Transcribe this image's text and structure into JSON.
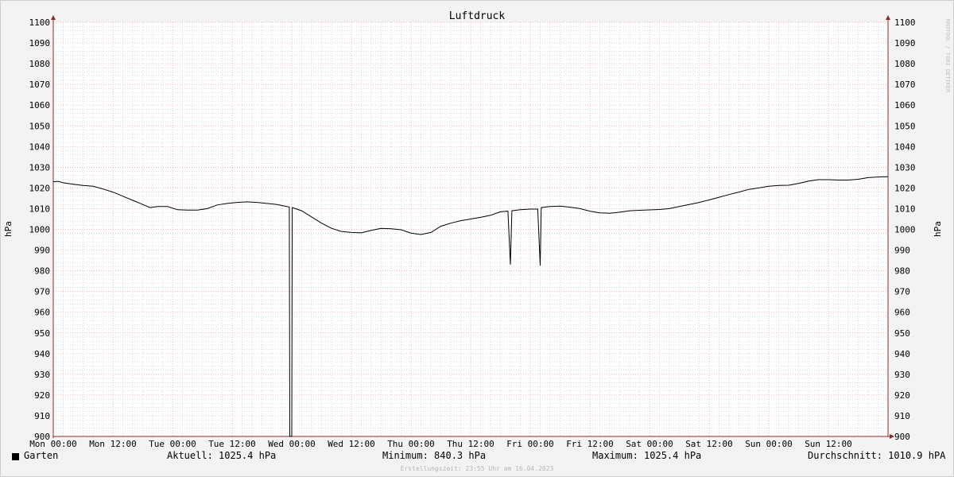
{
  "chart_data": {
    "type": "line",
    "title": "Luftdruck",
    "ylabel_left": "hPa",
    "ylabel_right": "hPa",
    "ylim": [
      900,
      1100
    ],
    "yticks": [
      900,
      910,
      920,
      930,
      940,
      950,
      960,
      970,
      980,
      990,
      1000,
      1010,
      1020,
      1030,
      1040,
      1050,
      1060,
      1070,
      1080,
      1090,
      1100
    ],
    "xlim": [
      0,
      168
    ],
    "xticks": [
      {
        "h": 0,
        "label": "Mon 00:00"
      },
      {
        "h": 12,
        "label": "Mon 12:00"
      },
      {
        "h": 24,
        "label": "Tue 00:00"
      },
      {
        "h": 36,
        "label": "Tue 12:00"
      },
      {
        "h": 48,
        "label": "Wed 00:00"
      },
      {
        "h": 60,
        "label": "Wed 12:00"
      },
      {
        "h": 72,
        "label": "Thu 00:00"
      },
      {
        "h": 84,
        "label": "Thu 12:00"
      },
      {
        "h": 96,
        "label": "Fri 00:00"
      },
      {
        "h": 108,
        "label": "Fri 12:00"
      },
      {
        "h": 120,
        "label": "Sat 00:00"
      },
      {
        "h": 132,
        "label": "Sat 12:00"
      },
      {
        "h": 144,
        "label": "Sun 00:00"
      },
      {
        "h": 156,
        "label": "Sun 12:00"
      }
    ],
    "grid": true,
    "series": [
      {
        "name": "Garten",
        "color": "#000000",
        "points": [
          [
            0,
            1023
          ],
          [
            1,
            1023.2
          ],
          [
            2,
            1022.5
          ],
          [
            4,
            1021.8
          ],
          [
            6,
            1021.2
          ],
          [
            8,
            1020.8
          ],
          [
            10,
            1019.5
          ],
          [
            12,
            1018
          ],
          [
            14,
            1016
          ],
          [
            16,
            1014
          ],
          [
            18,
            1012
          ],
          [
            19.5,
            1010.5
          ],
          [
            21,
            1011
          ],
          [
            23,
            1011
          ],
          [
            25,
            1009.5
          ],
          [
            27,
            1009.3
          ],
          [
            29,
            1009.3
          ],
          [
            31,
            1010
          ],
          [
            33,
            1011.8
          ],
          [
            35,
            1012.5
          ],
          [
            37,
            1013
          ],
          [
            39,
            1013.3
          ],
          [
            41,
            1013
          ],
          [
            43,
            1012.5
          ],
          [
            45,
            1012
          ],
          [
            47,
            1011
          ],
          [
            47.5,
            1010.8
          ],
          [
            47.6,
            840.3
          ],
          [
            48.0,
            840.3
          ],
          [
            48.1,
            1010.5
          ],
          [
            50,
            1009
          ],
          [
            52,
            1006
          ],
          [
            54,
            1003
          ],
          [
            56,
            1000.5
          ],
          [
            58,
            999
          ],
          [
            60,
            998.5
          ],
          [
            62,
            998.3
          ],
          [
            64,
            999.5
          ],
          [
            66,
            1000.5
          ],
          [
            68,
            1000.3
          ],
          [
            70,
            999.8
          ],
          [
            72,
            998.2
          ],
          [
            74,
            997.5
          ],
          [
            76,
            998.5
          ],
          [
            78,
            1001.5
          ],
          [
            80,
            1003
          ],
          [
            82,
            1004.2
          ],
          [
            84,
            1005
          ],
          [
            86,
            1005.8
          ],
          [
            88,
            1006.8
          ],
          [
            90,
            1008.5
          ],
          [
            91.5,
            1008.8
          ],
          [
            92.0,
            983
          ],
          [
            92.3,
            1009
          ],
          [
            94,
            1009.5
          ],
          [
            96,
            1009.8
          ],
          [
            97.5,
            1009.8
          ],
          [
            98.0,
            982.5
          ],
          [
            98.2,
            1010.5
          ],
          [
            100,
            1011
          ],
          [
            102,
            1011.2
          ],
          [
            104,
            1010.7
          ],
          [
            106,
            1010
          ],
          [
            108,
            1008.8
          ],
          [
            110,
            1008
          ],
          [
            112,
            1007.8
          ],
          [
            114,
            1008.3
          ],
          [
            116,
            1009
          ],
          [
            118,
            1009.2
          ],
          [
            120,
            1009.4
          ],
          [
            122,
            1009.6
          ],
          [
            124,
            1010
          ],
          [
            126,
            1011
          ],
          [
            128,
            1012
          ],
          [
            130,
            1013
          ],
          [
            132,
            1014.2
          ],
          [
            134,
            1015.5
          ],
          [
            136,
            1016.8
          ],
          [
            138,
            1018
          ],
          [
            140,
            1019.3
          ],
          [
            142,
            1020
          ],
          [
            144,
            1020.8
          ],
          [
            146,
            1021.2
          ],
          [
            148,
            1021.3
          ],
          [
            150,
            1022.2
          ],
          [
            152,
            1023.3
          ],
          [
            154,
            1024
          ],
          [
            156,
            1024
          ],
          [
            158,
            1023.8
          ],
          [
            160,
            1023.8
          ],
          [
            162,
            1024.2
          ],
          [
            164,
            1025
          ],
          [
            166,
            1025.3
          ],
          [
            168,
            1025.4
          ]
        ]
      }
    ]
  },
  "legend": {
    "series_name": "Garten",
    "current": "Aktuell: 1025.4 hPa",
    "minimum": "Minimum: 840.3 hPa",
    "maximum": "Maximum: 1025.4 hPa",
    "average": "Durchschnitt: 1010.9 hPA"
  },
  "footer": "Erstellungszeit: 23:55 Uhr am 16.04.2023",
  "watermark": "RRDTOOL / TOBI OETIKER",
  "colors": {
    "background": "#f3f3f3",
    "plot_background": "#ffffff",
    "major_grid": "#e8a0a0",
    "minor_grid": "#c8c8c8",
    "axis": "#8b2a2a",
    "line": "#000000"
  }
}
